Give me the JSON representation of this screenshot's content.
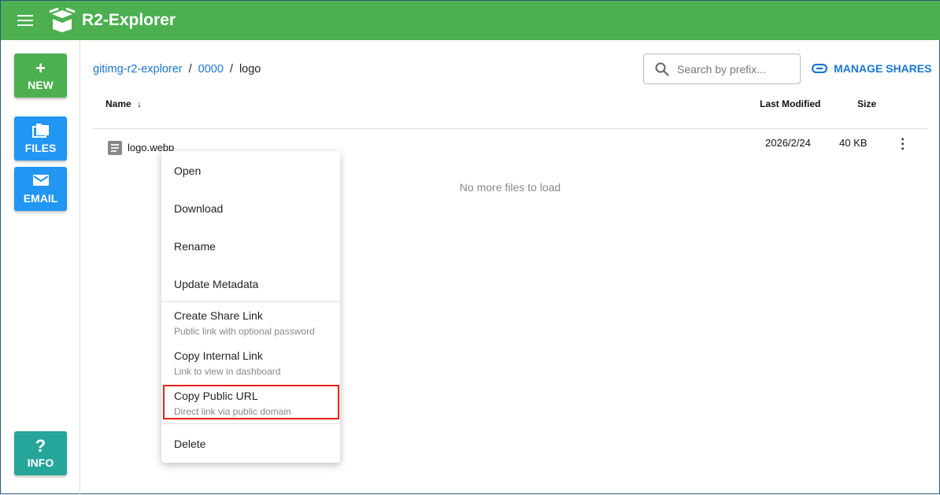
{
  "app": {
    "title": "R2-Explorer"
  },
  "sidebar": {
    "new": "NEW",
    "files": "FILES",
    "email": "EMAIL",
    "info": "INFO"
  },
  "breadcrumb": [
    "gitimg-r2-explorer",
    "0000",
    "logo"
  ],
  "search": {
    "placeholder": "Search by prefix..."
  },
  "manage_shares": "MANAGE SHARES",
  "table": {
    "headers": {
      "name": "Name",
      "modified": "Last Modified",
      "size": "Size"
    },
    "rows": [
      {
        "name": "logo.webp",
        "modified": "2026/2/24",
        "size": "40 KB"
      }
    ],
    "empty": "No more files to load"
  },
  "context_menu": [
    {
      "label": "Open"
    },
    {
      "label": "Download"
    },
    {
      "label": "Rename"
    },
    {
      "label": "Update Metadata"
    },
    {
      "label": "Create Share Link",
      "sub": "Public link with optional password"
    },
    {
      "label": "Copy Internal Link",
      "sub": "Link to view in dashboard"
    },
    {
      "label": "Copy Public URL",
      "sub": "Direct link via public domain"
    },
    {
      "label": "Delete"
    }
  ]
}
